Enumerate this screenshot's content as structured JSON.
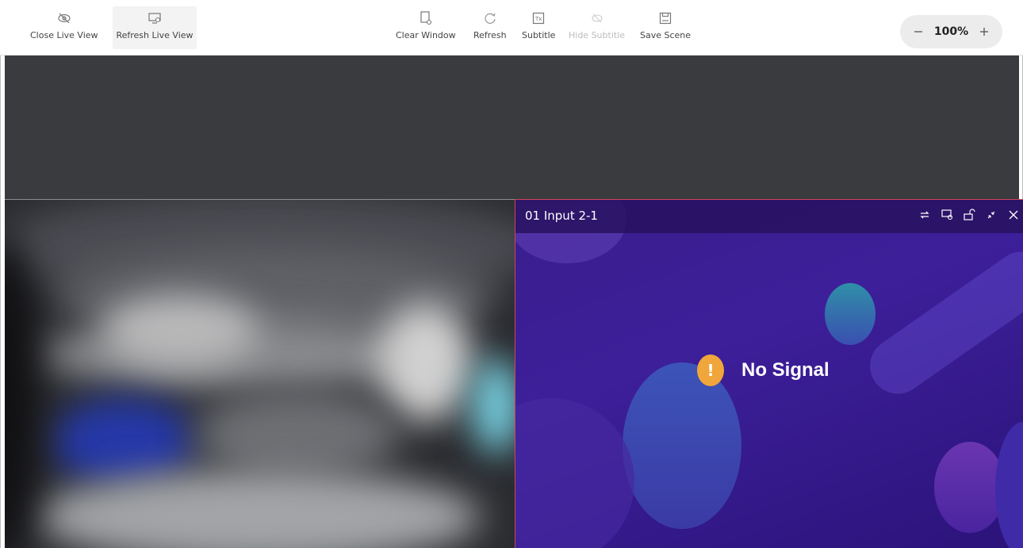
{
  "toolbar": {
    "close_live_view": "Close Live View",
    "refresh_live_view": "Refresh Live View",
    "clear_window": "Clear Window",
    "refresh": "Refresh",
    "subtitle": "Subtitle",
    "hide_subtitle": "Hide Subtitle",
    "save_scene": "Save Scene"
  },
  "zoom": {
    "value": "100%"
  },
  "window": {
    "title": "01  Input 2-1",
    "status_text": "No Signal",
    "warning_symbol": "!"
  },
  "icons": {
    "close_live_view": "eye-off-icon",
    "refresh_live_view": "monitor-refresh-icon",
    "clear_window": "window-clear-icon",
    "refresh": "refresh-icon",
    "subtitle": "subtitle-icon",
    "hide_subtitle": "hide-subtitle-icon",
    "save_scene": "save-icon",
    "window_actions": [
      "loop-icon",
      "screenshot-icon",
      "unlock-icon",
      "minimize-icon",
      "close-icon"
    ]
  },
  "colors": {
    "canvas": "#3a3b3f",
    "window_bg": "#3d1f9a",
    "window_border": "#d0445a",
    "warning": "#f0a63a"
  }
}
